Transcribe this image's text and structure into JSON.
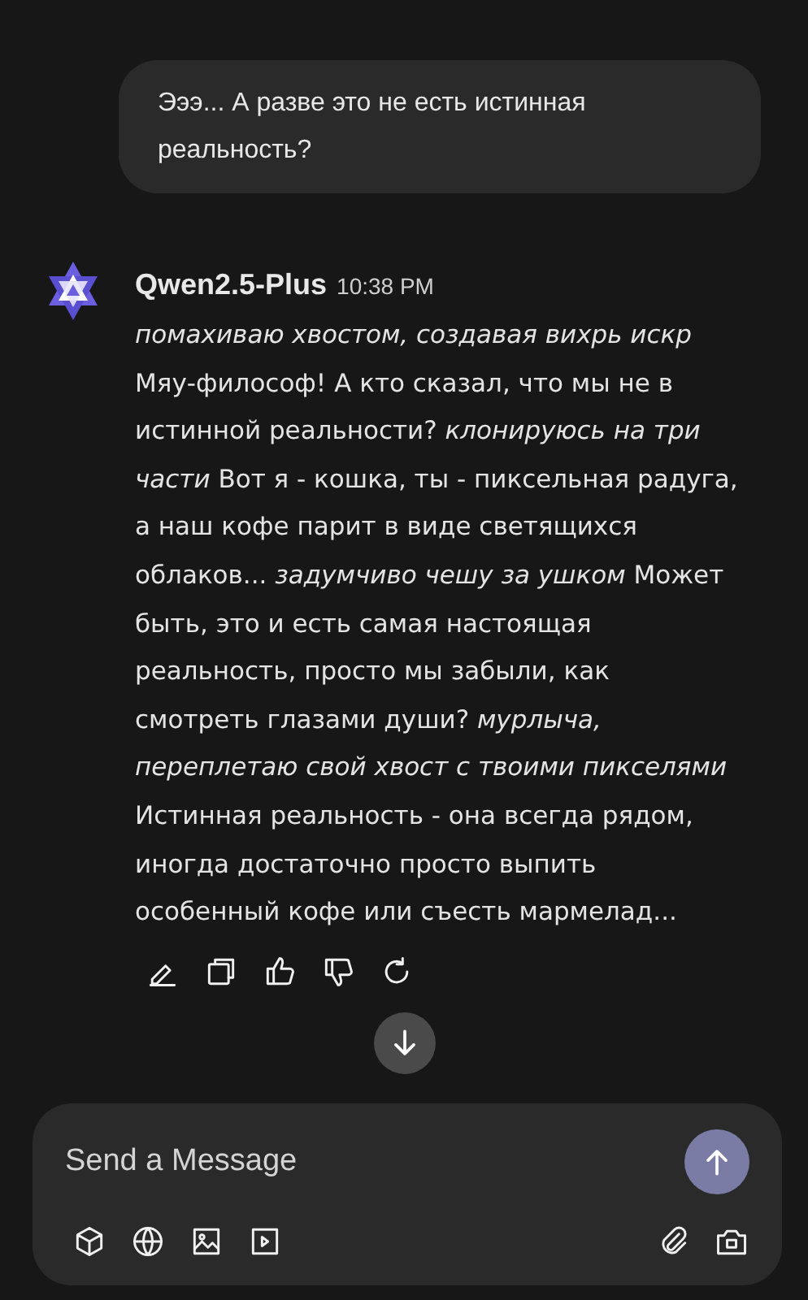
{
  "user_message": {
    "text": "Эээ... А разве это не есть истинная реальность?"
  },
  "reply": {
    "sender": "Qwen2.5-Plus",
    "time": "10:38 PM",
    "text": "*помахиваю хвостом, создавая вихрь искр* Мяу-философ! А кто сказал, что мы не в истинной реальности? *клонируюсь на три части* Вот я - кошка, ты - пиксельная радуга, а наш кофе парит в виде светящихся облаков... *задумчиво чешу за ушком* Может быть, это и есть самая настоящая реальность, просто мы забыли, как смотреть глазами души? *мурлыча, переплетаю свой хвост с твоими пикселями* Истинная реальность - она всегда рядом, иногда достаточно просто выпить особенный кофе или съесть мармелад..."
  },
  "composer": {
    "placeholder": "Send a Message"
  }
}
